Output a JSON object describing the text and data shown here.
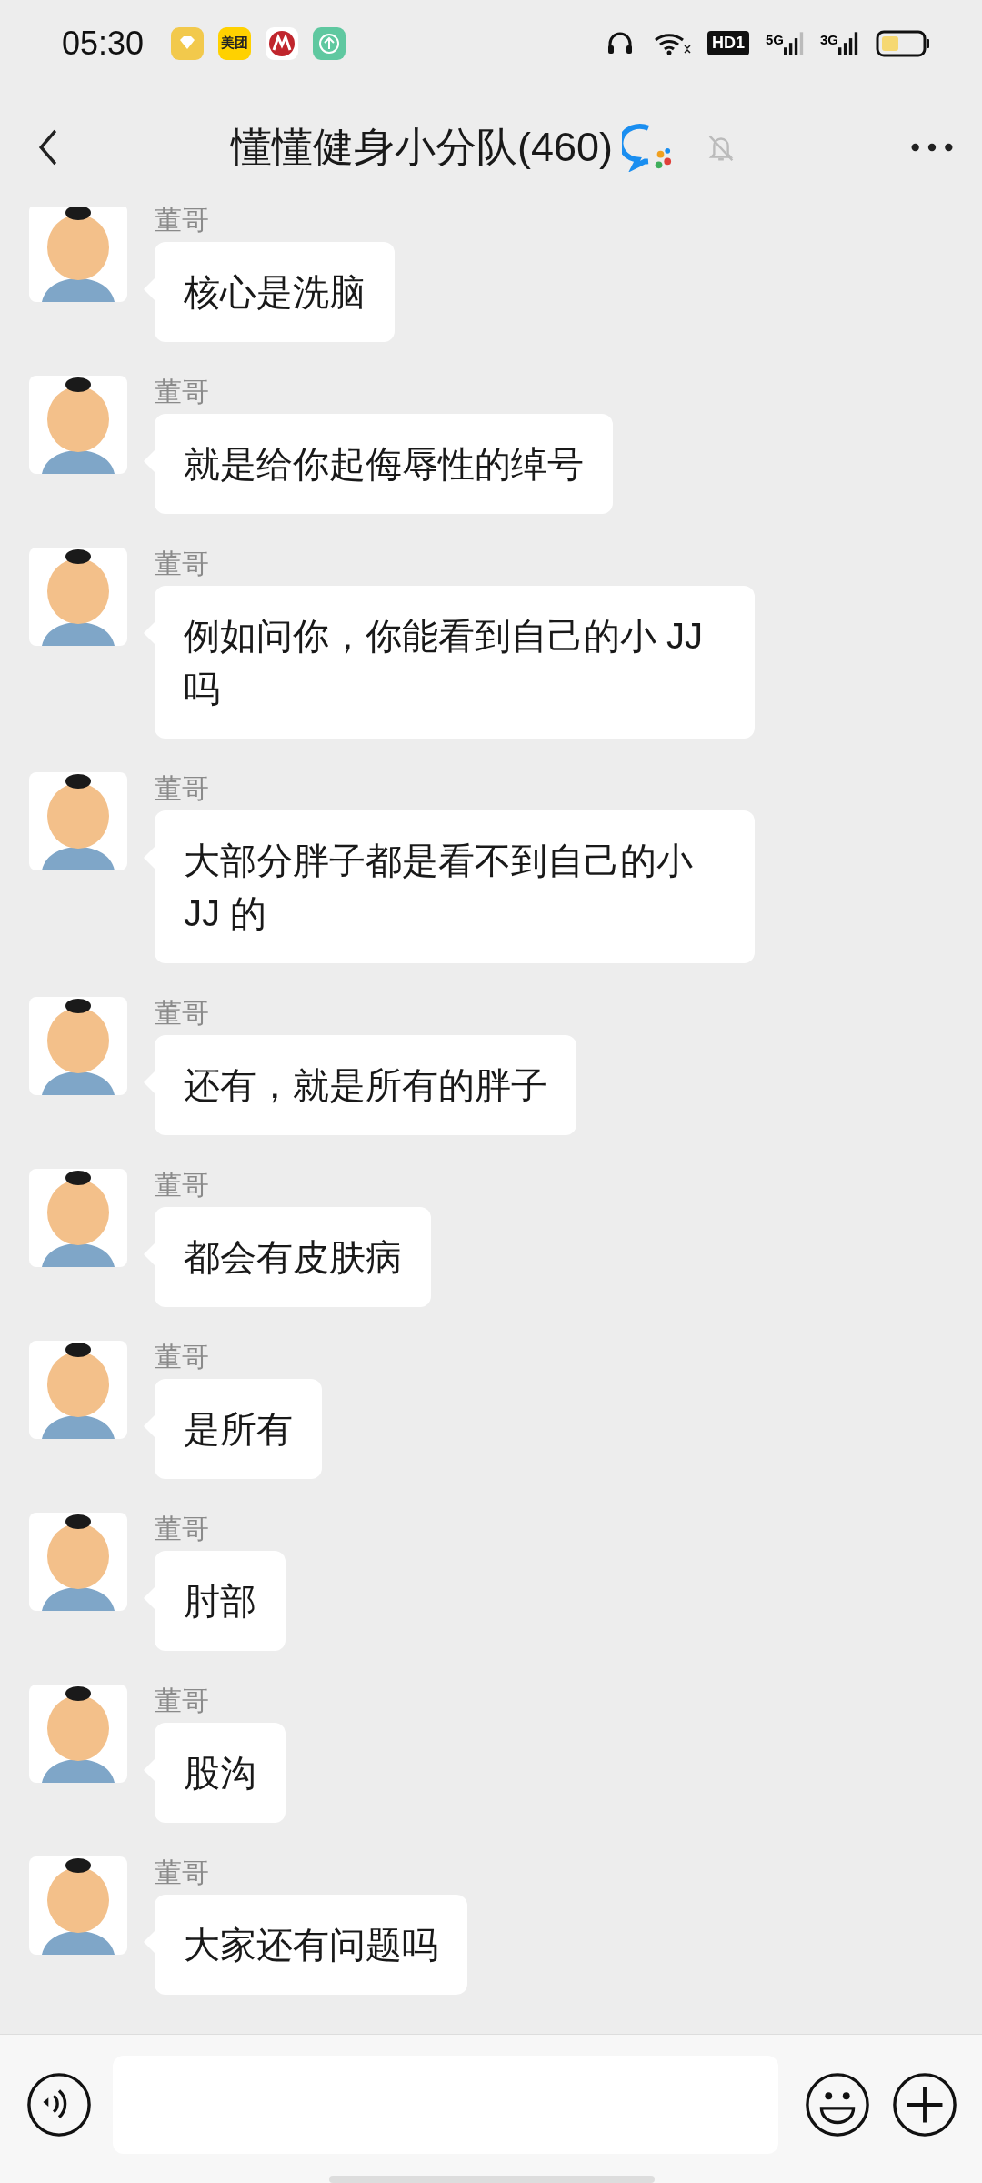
{
  "status_bar": {
    "time": "05:30",
    "notification_icons": [
      {
        "kind": "diamond"
      },
      {
        "kind": "text",
        "label": "美团"
      },
      {
        "kind": "bank"
      },
      {
        "kind": "upload"
      }
    ],
    "hd_label": "HD1",
    "signals": [
      {
        "label": "5G"
      },
      {
        "label": "3G"
      }
    ]
  },
  "header": {
    "title": "懂懂健身小分队(460)",
    "muted": true
  },
  "messages": [
    {
      "sender": "董哥",
      "text": "核心是洗脑"
    },
    {
      "sender": "董哥",
      "text": "就是给你起侮辱性的绰号"
    },
    {
      "sender": "董哥",
      "text": "例如问你，你能看到自己的小 JJ 吗"
    },
    {
      "sender": "董哥",
      "text": "大部分胖子都是看不到自己的小 JJ 的"
    },
    {
      "sender": "董哥",
      "text": "还有，就是所有的胖子"
    },
    {
      "sender": "董哥",
      "text": "都会有皮肤病"
    },
    {
      "sender": "董哥",
      "text": "是所有"
    },
    {
      "sender": "董哥",
      "text": "肘部"
    },
    {
      "sender": "董哥",
      "text": "股沟"
    },
    {
      "sender": "董哥",
      "text": "大家还有问题吗"
    }
  ]
}
